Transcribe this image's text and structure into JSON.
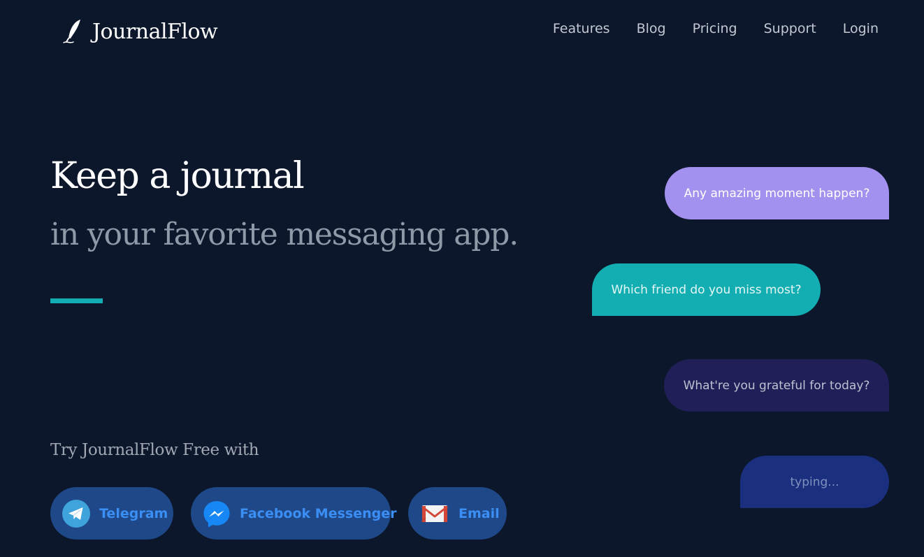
{
  "brand": {
    "name": "JournalFlow",
    "logo_icon": "feather-quill-icon"
  },
  "nav": {
    "links": [
      {
        "label": "Features"
      },
      {
        "label": "Blog"
      },
      {
        "label": "Pricing"
      },
      {
        "label": "Support"
      },
      {
        "label": "Login"
      }
    ]
  },
  "hero": {
    "headline": "Keep a journal",
    "subheadline": "in your favorite messaging app.",
    "try_text": "Try JournalFlow Free with"
  },
  "cta_buttons": [
    {
      "label": "Telegram",
      "icon": "telegram-icon"
    },
    {
      "label": "Facebook Messenger",
      "icon": "messenger-icon"
    },
    {
      "label": "Email",
      "icon": "gmail-icon"
    }
  ],
  "chat_bubbles": [
    {
      "text": "Any amazing moment happen?",
      "color": "#a490ee"
    },
    {
      "text": "Which friend do you miss most?",
      "color": "#12aeb1"
    },
    {
      "text": "What're you grateful for today?",
      "color": "#201f57"
    },
    {
      "text": "typing...",
      "color": "#1a2f7e"
    }
  ],
  "colors": {
    "background": "#0c172b",
    "accent": "#13aeb3",
    "button_bg": "#1e4888",
    "button_text": "#3b8ff4"
  }
}
